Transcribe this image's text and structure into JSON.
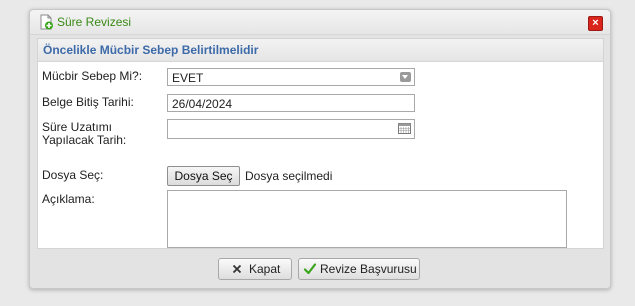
{
  "dialog": {
    "title": "Süre Revizesi",
    "close_icon": "close-icon",
    "title_icon": "add-document-icon"
  },
  "panel": {
    "header": "Öncelikle Mücbir Sebep Belirtilmelidir"
  },
  "form": {
    "force_majeure_label": "Mücbir Sebep Mi?:",
    "force_majeure_value": "EVET",
    "end_date_label": "Belge Bitiş Tarihi:",
    "end_date_value": "26/04/2024",
    "extension_date_label_line1": "Süre Uzatımı",
    "extension_date_label_line2": "Yapılacak Tarih:",
    "extension_date_value": "",
    "file_label": "Dosya Seç:",
    "file_button": "Dosya Seç",
    "file_status": "Dosya seçilmedi",
    "description_label": "Açıklama:",
    "description_value": ""
  },
  "buttons": {
    "close_label": "Kapat",
    "submit_label": "Revize Başvurusu"
  },
  "colors": {
    "title_green": "#3a8a16",
    "header_blue": "#3d6aa8",
    "close_red": "#d9251c"
  }
}
